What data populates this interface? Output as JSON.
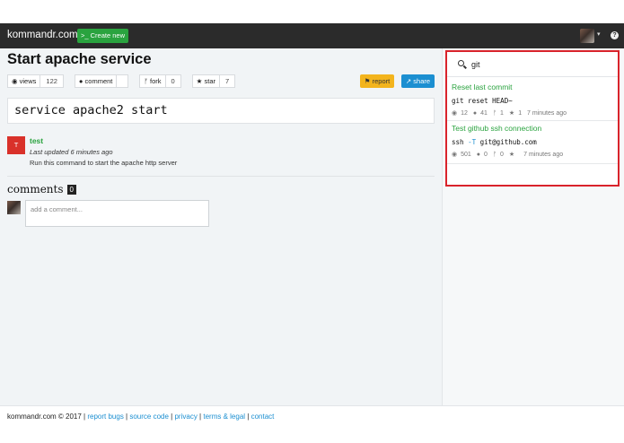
{
  "nav": {
    "brand": "kommandr.com",
    "create_label": ">_ Create new",
    "help_label": "?"
  },
  "command": {
    "title": "Start apache service",
    "text": "service apache2 start",
    "stats": {
      "views_label": "views",
      "views": "122",
      "comment_label": "comment",
      "comment_count": "",
      "fork_label": "fork",
      "forks": "0",
      "star_label": "star",
      "stars": "7"
    },
    "report_label": "report",
    "share_label": "share"
  },
  "author": {
    "initial": "T",
    "name": "test",
    "updated": "Last updated 6 minutes ago",
    "description": "Run this command to start the apache http server"
  },
  "comments": {
    "heading": "comments",
    "count": "0",
    "placeholder": "add a comment..."
  },
  "search": {
    "query": "git",
    "results": [
      {
        "title": "Reset last commit",
        "command": "git reset HEAD~",
        "views": "12",
        "comments": "41",
        "forks": "1",
        "stars": "1",
        "time": "7 minutes ago"
      },
      {
        "title": "Test github ssh connection",
        "command_prefix": "ssh ",
        "command_flag": "-T",
        "command_rest": " git@github.com",
        "views": "501",
        "comments": "0",
        "forks": "0",
        "stars": "",
        "time": "7 minutes ago"
      }
    ]
  },
  "footer": {
    "copyright": "kommandr.com © 2017",
    "links": [
      "report bugs",
      "source code",
      "privacy",
      "terms & legal",
      "contact"
    ]
  },
  "colors": {
    "accent_green": "#2aa33f",
    "share_blue": "#1c8fd1",
    "report_yellow": "#f3b41d",
    "highlight_red": "#d9232b",
    "navbar": "#2b2b2b"
  }
}
